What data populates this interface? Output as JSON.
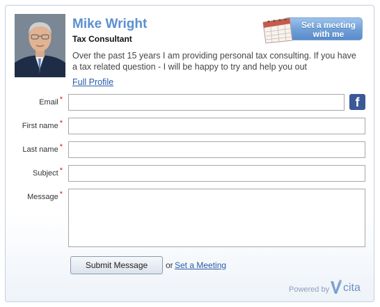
{
  "profile": {
    "name": "Mike Wright",
    "title": "Tax Consultant",
    "bio": "Over the past 15 years I am providing personal tax consulting. If you have a tax related question - I will be happy to try and help you out",
    "full_profile_link": "Full Profile"
  },
  "meeting_button": {
    "label_line1": "Set a meeting",
    "label_line2": "with me",
    "icon": "calendar-icon"
  },
  "form": {
    "required_mark": "*",
    "fields": [
      {
        "label": "Email",
        "value": ""
      },
      {
        "label": "First name",
        "value": ""
      },
      {
        "label": "Last name",
        "value": ""
      },
      {
        "label": "Subject",
        "value": ""
      },
      {
        "label": "Message",
        "value": ""
      }
    ],
    "facebook_icon": "facebook-icon",
    "facebook_glyph": "f"
  },
  "actions": {
    "submit_label": "Submit Message",
    "or_text": "or",
    "set_meeting_link": "Set a Meeting"
  },
  "footer": {
    "powered_by": "Powered by",
    "brand": "cita"
  },
  "colors": {
    "name": "#5b8fd1",
    "link": "#2a5aa8",
    "required": "#dd1111",
    "button_blue": "#6e9fd7",
    "facebook": "#3b5998"
  }
}
